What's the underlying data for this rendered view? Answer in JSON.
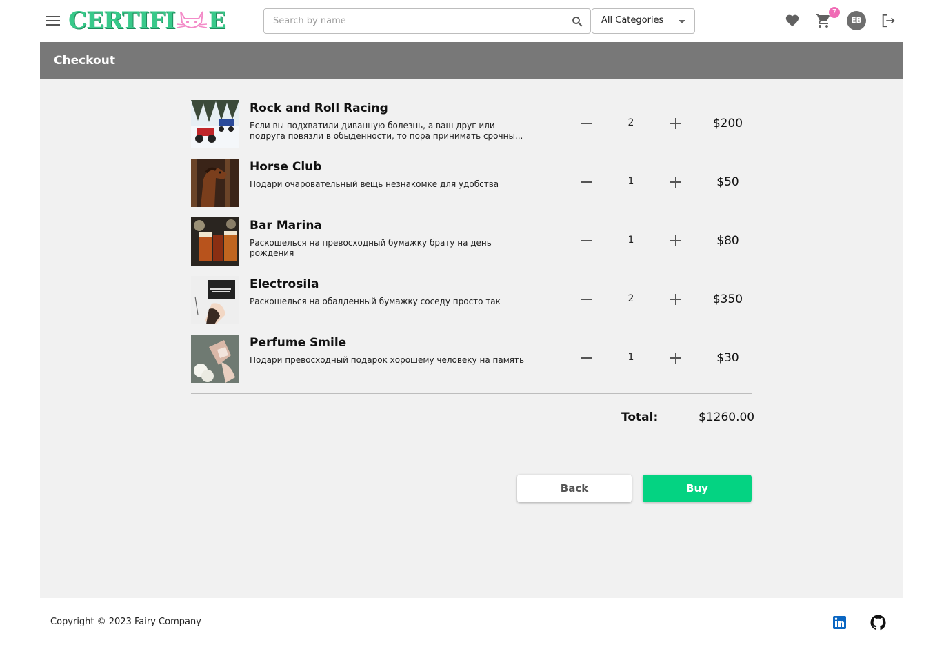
{
  "header": {
    "logo_text_left": "CERTIFI",
    "logo_text_right": "E",
    "search_placeholder": "Search by name",
    "category_selected": "All Categories",
    "cart_count": "7",
    "avatar_initials": "EB"
  },
  "page": {
    "title": "Checkout"
  },
  "items": [
    {
      "title": "Rock and Roll Racing",
      "description": "Если вы подхватили диванную болезнь, а ваш друг или подруга повязли в обыденности, то пора принимать срочны...",
      "quantity": "2",
      "price": "$200"
    },
    {
      "title": "Horse Club",
      "description": "Подари очаровательный вещь незнакомке для удобства",
      "quantity": "1",
      "price": "$50"
    },
    {
      "title": "Bar Marina",
      "description": "Раскошелься на превосходный бумажку брату на день рождения",
      "quantity": "1",
      "price": "$80"
    },
    {
      "title": "Electrosila",
      "description": "Раскошелься на обалденный бумажку соседу просто так",
      "quantity": "2",
      "price": "$350"
    },
    {
      "title": "Perfume Smile",
      "description": "Подари превосходный подарок хорошему человеку на память",
      "quantity": "1",
      "price": "$30"
    }
  ],
  "summary": {
    "total_label": "Total:",
    "total_value": "$1260.00"
  },
  "actions": {
    "back_label": "Back",
    "buy_label": "Buy"
  },
  "footer": {
    "copyright": "Copyright © 2023 Fairy Company"
  },
  "colors": {
    "brand_green": "#38c98a",
    "buy_green": "#04d382",
    "badge_pink": "#f06bb5",
    "title_bar": "#787878"
  },
  "icons": [
    "menu-icon",
    "search-icon",
    "chevron-down-icon",
    "heart-icon",
    "cart-icon",
    "logout-icon",
    "minus-icon",
    "plus-icon",
    "linkedin-icon",
    "github-icon"
  ]
}
